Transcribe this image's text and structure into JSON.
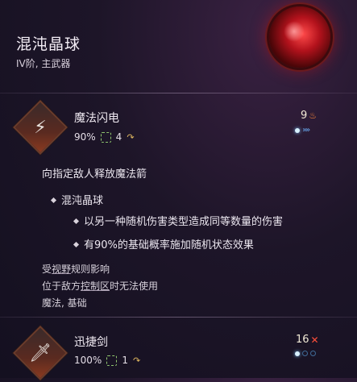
{
  "item": {
    "title": "混沌晶球",
    "subtitle": "IV阶, 主武器",
    "orb_icon": "chaos-orb-icon"
  },
  "abilities": [
    {
      "name": "魔法闪电",
      "icon": "magic-bolt-icon",
      "hit_chance": "90%",
      "movement": "4",
      "ap_cost": "9",
      "cost_icon": "fire-icon",
      "cooldown_pips": 1,
      "cooldown_empty": 0,
      "arrows": "»»",
      "description": "向指定敌人释放魔法箭",
      "effects_header": "混沌晶球",
      "effects": [
        "以另一种随机伤害类型造成同等数量的伤害",
        "有90%的基础概率施加随机状态效果"
      ],
      "notes": {
        "line1_prefix": "受",
        "line1_keyword": "视野",
        "line1_suffix": "规则影响",
        "line2_prefix": "位于敌方",
        "line2_keyword": "控制区",
        "line2_suffix": "时无法使用",
        "tags": "魔法, 基础"
      }
    },
    {
      "name": "迅捷剑",
      "icon": "swift-sword-icon",
      "hit_chance": "100%",
      "movement": "1",
      "ap_cost": "16",
      "cost_icon": "crossed-swords-icon",
      "cooldown_pips": 1,
      "cooldown_empty": 2
    }
  ],
  "colors": {
    "background": "#1d1528",
    "orb": "#b3121c",
    "hit_icon": "#8fc46e",
    "move_icon": "#e0b860",
    "pip": "#d9f1ff"
  }
}
